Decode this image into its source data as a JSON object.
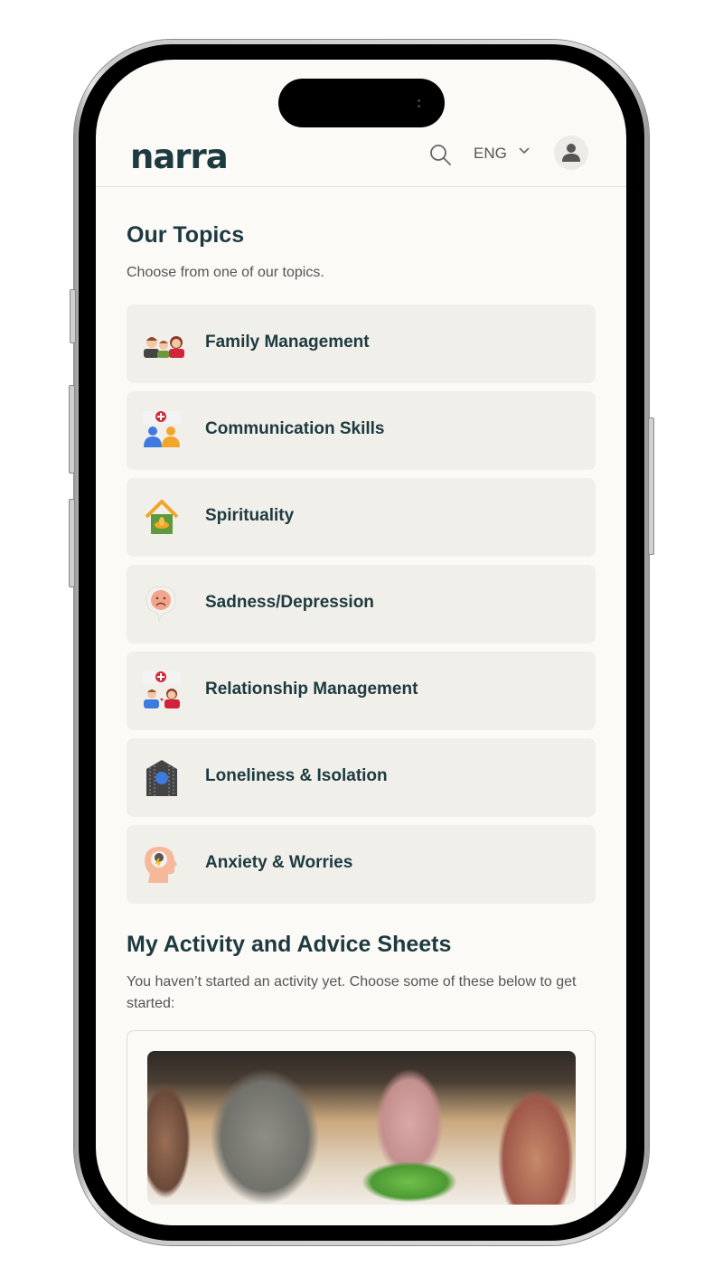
{
  "header": {
    "logo": "narra",
    "language": "ENG",
    "icons": {
      "search": "search-icon",
      "language_dropdown": "chevron-down-icon",
      "profile": "user-icon"
    }
  },
  "topics_section": {
    "title": "Our Topics",
    "subtitle": "Choose from one of our topics.",
    "items": [
      {
        "label": "Family Management",
        "icon": "family-icon"
      },
      {
        "label": "Communication Skills",
        "icon": "communication-icon"
      },
      {
        "label": "Spirituality",
        "icon": "spirituality-house-icon"
      },
      {
        "label": "Sadness/Depression",
        "icon": "sad-face-icon"
      },
      {
        "label": "Relationship Management",
        "icon": "couple-icon"
      },
      {
        "label": "Loneliness & Isolation",
        "icon": "isolation-house-icon"
      },
      {
        "label": "Anxiety & Worries",
        "icon": "anxious-head-icon"
      }
    ]
  },
  "activity_section": {
    "title": "My Activity and Advice Sheets",
    "subtitle": "You haven’t started an activity yet. Choose some of these below to get started:",
    "card_image": "family-dinner-photo"
  },
  "colors": {
    "brand_text": "#1d3a40",
    "background": "#fbfaf7",
    "topic_card": "#f0efe9"
  }
}
